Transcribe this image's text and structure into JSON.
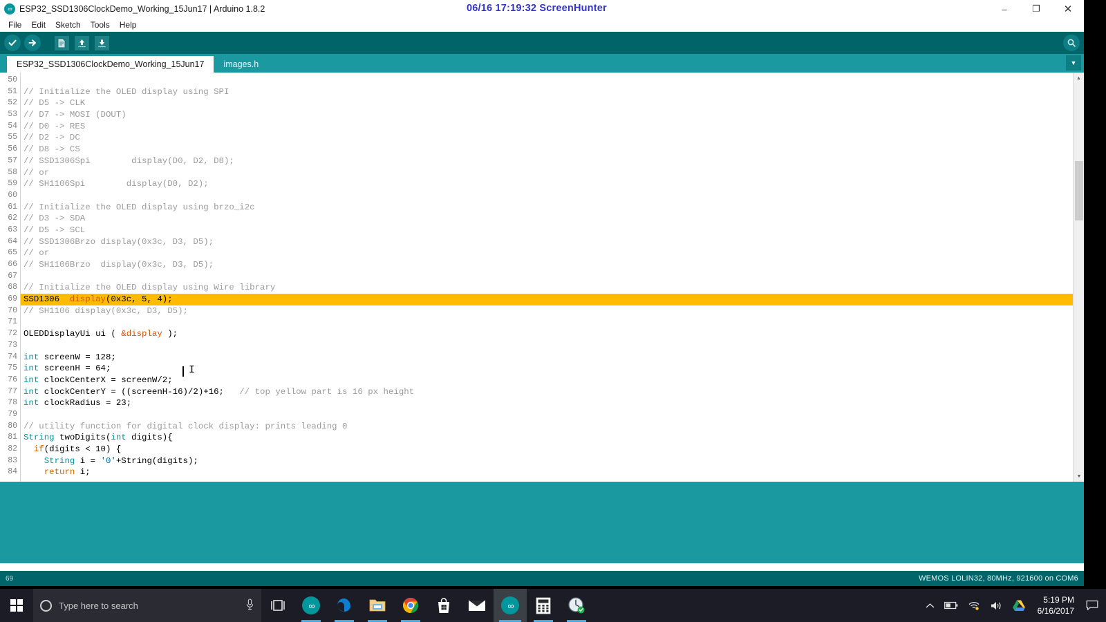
{
  "window": {
    "title": "ESP32_SSD1306ClockDemo_Working_15Jun17 | Arduino 1.8.2",
    "app_icon": "arduino-infinity-icon",
    "minimize_label": "–",
    "maximize_label": "❐",
    "close_label": "✕"
  },
  "overlay": {
    "screenhunter_text": "06/16  17:19:32  ScreenHunter",
    "color": "#3333cc"
  },
  "menu": {
    "items": [
      {
        "label": "File"
      },
      {
        "label": "Edit"
      },
      {
        "label": "Sketch"
      },
      {
        "label": "Tools"
      },
      {
        "label": "Help"
      }
    ]
  },
  "toolbar": {
    "background": "#006468",
    "buttons": [
      {
        "name": "verify-button",
        "icon": "checkmark-icon",
        "glyph": "✓"
      },
      {
        "name": "upload-button",
        "icon": "arrow-right-icon",
        "glyph": "→"
      },
      {
        "name": "new-button",
        "icon": "new-document-icon",
        "glyph": "▤"
      },
      {
        "name": "open-button",
        "icon": "arrow-up-icon",
        "glyph": "↑"
      },
      {
        "name": "save-button",
        "icon": "arrow-down-icon",
        "glyph": "↓"
      }
    ],
    "serial_monitor": {
      "name": "serial-monitor-button",
      "icon": "magnifier-icon",
      "glyph": "⚲"
    }
  },
  "tabs": {
    "items": [
      {
        "label": "ESP32_SSD1306ClockDemo_Working_15Jun17",
        "active": true
      },
      {
        "label": "images.h",
        "active": false
      }
    ],
    "menu_glyph": "▼"
  },
  "editor": {
    "first_line_number": 50,
    "highlighted_line": 69,
    "lines": [
      {
        "n": 50,
        "tokens": []
      },
      {
        "n": 51,
        "tokens": [
          {
            "t": "comment",
            "s": "// Initialize the OLED display using SPI"
          }
        ]
      },
      {
        "n": 52,
        "tokens": [
          {
            "t": "comment",
            "s": "// D5 -> CLK"
          }
        ]
      },
      {
        "n": 53,
        "tokens": [
          {
            "t": "comment",
            "s": "// D7 -> MOSI (DOUT)"
          }
        ]
      },
      {
        "n": 54,
        "tokens": [
          {
            "t": "comment",
            "s": "// D0 -> RES"
          }
        ]
      },
      {
        "n": 55,
        "tokens": [
          {
            "t": "comment",
            "s": "// D2 -> DC"
          }
        ]
      },
      {
        "n": 56,
        "tokens": [
          {
            "t": "comment",
            "s": "// D8 -> CS"
          }
        ]
      },
      {
        "n": 57,
        "tokens": [
          {
            "t": "comment",
            "s": "// SSD1306Spi        display(D0, D2, D8);"
          }
        ]
      },
      {
        "n": 58,
        "tokens": [
          {
            "t": "comment",
            "s": "// or"
          }
        ]
      },
      {
        "n": 59,
        "tokens": [
          {
            "t": "comment",
            "s": "// SH1106Spi        display(D0, D2);"
          }
        ]
      },
      {
        "n": 60,
        "tokens": []
      },
      {
        "n": 61,
        "tokens": [
          {
            "t": "comment",
            "s": "// Initialize the OLED display using brzo_i2c"
          }
        ]
      },
      {
        "n": 62,
        "tokens": [
          {
            "t": "comment",
            "s": "// D3 -> SDA"
          }
        ]
      },
      {
        "n": 63,
        "tokens": [
          {
            "t": "comment",
            "s": "// D5 -> SCL"
          }
        ]
      },
      {
        "n": 64,
        "tokens": [
          {
            "t": "comment",
            "s": "// SSD1306Brzo display(0x3c, D3, D5);"
          }
        ]
      },
      {
        "n": 65,
        "tokens": [
          {
            "t": "comment",
            "s": "// or"
          }
        ]
      },
      {
        "n": 66,
        "tokens": [
          {
            "t": "comment",
            "s": "// SH1106Brzo  display(0x3c, D3, D5);"
          }
        ]
      },
      {
        "n": 67,
        "tokens": []
      },
      {
        "n": 68,
        "tokens": [
          {
            "t": "comment",
            "s": "// Initialize the OLED display using Wire library"
          }
        ]
      },
      {
        "n": 69,
        "highlight": true,
        "tokens": [
          {
            "t": "plain",
            "s": "SSD1306  "
          },
          {
            "t": "func",
            "s": "display"
          },
          {
            "t": "plain",
            "s": "(0x3c, 5, 4);"
          }
        ]
      },
      {
        "n": 70,
        "tokens": [
          {
            "t": "comment",
            "s": "// SH1106 display(0x3c, D3, D5);"
          }
        ]
      },
      {
        "n": 71,
        "tokens": []
      },
      {
        "n": 72,
        "tokens": [
          {
            "t": "plain",
            "s": "OLEDDisplayUi ui ( "
          },
          {
            "t": "func",
            "s": "&display"
          },
          {
            "t": "plain",
            "s": " );"
          }
        ]
      },
      {
        "n": 73,
        "tokens": []
      },
      {
        "n": 74,
        "tokens": [
          {
            "t": "type",
            "s": "int"
          },
          {
            "t": "plain",
            "s": " screenW = 128;"
          }
        ]
      },
      {
        "n": 75,
        "tokens": [
          {
            "t": "type",
            "s": "int"
          },
          {
            "t": "plain",
            "s": " screenH = 64;"
          }
        ]
      },
      {
        "n": 76,
        "tokens": [
          {
            "t": "type",
            "s": "int"
          },
          {
            "t": "plain",
            "s": " clockCenterX = screenW/2;"
          }
        ]
      },
      {
        "n": 77,
        "tokens": [
          {
            "t": "type",
            "s": "int"
          },
          {
            "t": "plain",
            "s": " clockCenterY = ((screenH-16)/2)+16;   "
          },
          {
            "t": "comment",
            "s": "// top yellow part is 16 px height"
          }
        ]
      },
      {
        "n": 78,
        "tokens": [
          {
            "t": "type",
            "s": "int"
          },
          {
            "t": "plain",
            "s": " clockRadius = 23;"
          }
        ]
      },
      {
        "n": 79,
        "tokens": []
      },
      {
        "n": 80,
        "tokens": [
          {
            "t": "comment",
            "s": "// utility function for digital clock display: prints leading 0"
          }
        ]
      },
      {
        "n": 81,
        "tokens": [
          {
            "t": "type",
            "s": "String"
          },
          {
            "t": "plain",
            "s": " twoDigits("
          },
          {
            "t": "type",
            "s": "int"
          },
          {
            "t": "plain",
            "s": " digits){"
          }
        ]
      },
      {
        "n": 82,
        "tokens": [
          {
            "t": "plain",
            "s": "  "
          },
          {
            "t": "keyword",
            "s": "if"
          },
          {
            "t": "plain",
            "s": "(digits < 10) {"
          }
        ]
      },
      {
        "n": 83,
        "tokens": [
          {
            "t": "plain",
            "s": "    "
          },
          {
            "t": "type",
            "s": "String"
          },
          {
            "t": "plain",
            "s": " i = "
          },
          {
            "t": "string",
            "s": "'0'"
          },
          {
            "t": "plain",
            "s": "+String(digits);"
          }
        ]
      },
      {
        "n": 84,
        "tokens": [
          {
            "t": "plain",
            "s": "    "
          },
          {
            "t": "keyword",
            "s": "return"
          },
          {
            "t": "plain",
            "s": " i;"
          }
        ]
      }
    ],
    "scrollbar": {
      "up_glyph": "▲",
      "down_glyph": "▼"
    }
  },
  "status": {
    "line_number": "69",
    "board_info": "WEMOS LOLIN32, 80MHz, 921600 on COM6"
  },
  "taskbar": {
    "search_placeholder": "Type here to search",
    "search_icon": "circle-search-icon",
    "mic_icon": "microphone-icon",
    "start_icon": "windows-logo-icon",
    "items": [
      {
        "name": "task-view-button",
        "icon": "task-view-icon"
      },
      {
        "name": "taskbar-arduino-1",
        "icon": "arduino-icon",
        "running": true
      },
      {
        "name": "taskbar-edge",
        "icon": "edge-icon",
        "running": true
      },
      {
        "name": "taskbar-file-explorer",
        "icon": "folder-icon",
        "running": true
      },
      {
        "name": "taskbar-chrome",
        "icon": "chrome-icon",
        "running": true
      },
      {
        "name": "taskbar-store",
        "icon": "store-icon",
        "running": false
      },
      {
        "name": "taskbar-mail",
        "icon": "mail-icon",
        "running": false
      },
      {
        "name": "taskbar-arduino-active",
        "icon": "arduino-icon",
        "active": true
      },
      {
        "name": "taskbar-calculator",
        "icon": "calculator-icon",
        "running": true
      },
      {
        "name": "taskbar-screenhunter",
        "icon": "screenhunter-clock-icon",
        "running": true
      }
    ],
    "tray": {
      "chevron": "⌃",
      "battery_icon": "battery-icon",
      "wifi_icon": "wifi-icon",
      "volume_icon": "speaker-icon",
      "drive_icon": "google-drive-icon",
      "time": "5:19 PM",
      "date": "6/16/2017",
      "action_center_icon": "action-center-icon"
    }
  }
}
